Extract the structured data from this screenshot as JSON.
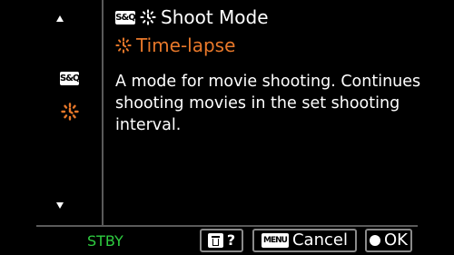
{
  "sidebar": {
    "up_arrow_icon": "up-arrow-icon",
    "down_arrow_icon": "down-arrow-icon",
    "items": [
      {
        "badge": "S&Q",
        "icon": "sq-badge-icon"
      },
      {
        "icon": "timelapse-icon",
        "color": "#e8782a"
      }
    ]
  },
  "header": {
    "badge": "S&Q",
    "icon": "timelapse-icon",
    "title": "Shoot Mode"
  },
  "selection": {
    "icon": "timelapse-icon",
    "label": "Time-lapse",
    "color": "#e8782a"
  },
  "description": "A mode for movie shooting. Continues shooting movies in the set shooting interval.",
  "status": {
    "label": "STBY",
    "color": "#2ecc40"
  },
  "softkeys": {
    "help": {
      "icon": "trash-icon",
      "label": "?"
    },
    "cancel": {
      "icon_label": "MENU",
      "label": "Cancel"
    },
    "ok": {
      "icon": "center-button-icon",
      "label": "OK"
    }
  }
}
